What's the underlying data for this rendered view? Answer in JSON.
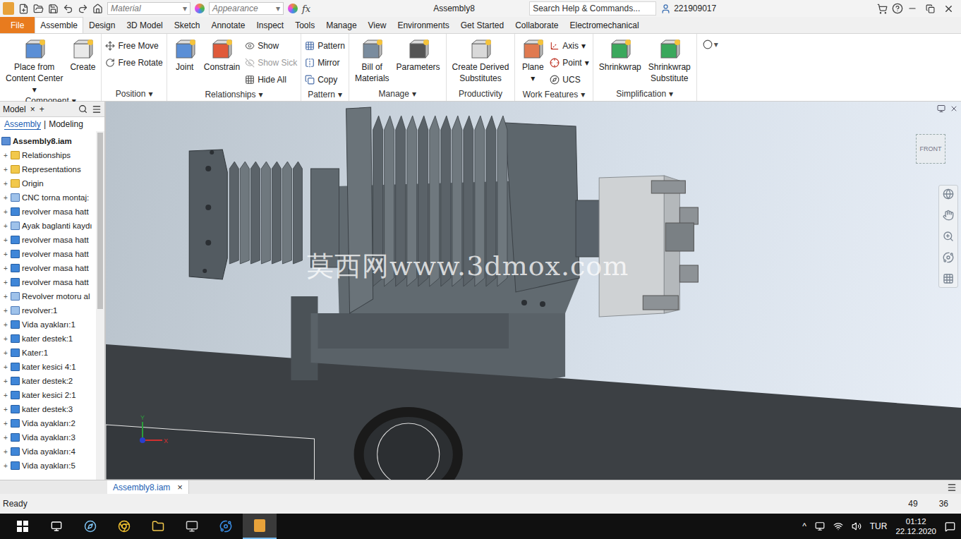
{
  "window": {
    "title": "Assembly8"
  },
  "quick_access": {
    "material": "Material",
    "appearance": "Appearance",
    "fx": "fx"
  },
  "search": {
    "placeholder": "Search Help & Commands..."
  },
  "user": "221909017",
  "tabs": [
    {
      "label": "File",
      "selected": false,
      "kind": "file"
    },
    {
      "label": "Assemble",
      "selected": true,
      "kind": "tab"
    },
    {
      "label": "Design",
      "selected": false,
      "kind": "tab"
    },
    {
      "label": "3D Model",
      "selected": false,
      "kind": "tab"
    },
    {
      "label": "Sketch",
      "selected": false,
      "kind": "tab"
    },
    {
      "label": "Annotate",
      "selected": false,
      "kind": "tab"
    },
    {
      "label": "Inspect",
      "selected": false,
      "kind": "tab"
    },
    {
      "label": "Tools",
      "selected": false,
      "kind": "tab"
    },
    {
      "label": "Manage",
      "selected": false,
      "kind": "tab"
    },
    {
      "label": "View",
      "selected": false,
      "kind": "tab"
    },
    {
      "label": "Environments",
      "selected": false,
      "kind": "tab"
    },
    {
      "label": "Get Started",
      "selected": false,
      "kind": "tab"
    },
    {
      "label": "Collaborate",
      "selected": false,
      "kind": "tab"
    },
    {
      "label": "Electromechanical",
      "selected": false,
      "kind": "tab"
    }
  ],
  "ribbon": {
    "dropdown_glyph": "▾",
    "groups": [
      {
        "label": "Component",
        "dropdown": true,
        "buttons": [
          {
            "lines": [
              "Place from",
              "Content Center"
            ],
            "kind": "large",
            "disabled": false,
            "dropdown": true
          },
          {
            "lines": [
              "Create"
            ],
            "kind": "large",
            "disabled": false,
            "dropdown": false
          }
        ]
      },
      {
        "label": "Position",
        "dropdown": true,
        "buttons": [
          {
            "lines": [
              "Free Move"
            ],
            "kind": "small",
            "disabled": false,
            "dropdown": false
          },
          {
            "lines": [
              "Free Rotate"
            ],
            "kind": "small",
            "disabled": false,
            "dropdown": false
          }
        ]
      },
      {
        "label": "Relationships",
        "dropdown": true,
        "buttons": [
          {
            "lines": [
              "Joint"
            ],
            "kind": "large",
            "disabled": false,
            "dropdown": false
          },
          {
            "lines": [
              "Constrain"
            ],
            "kind": "large",
            "disabled": false,
            "dropdown": false
          },
          {
            "lines": [
              "Show"
            ],
            "kind": "small",
            "disabled": false,
            "dropdown": false
          },
          {
            "lines": [
              "Show Sick"
            ],
            "kind": "small",
            "disabled": true,
            "dropdown": false
          },
          {
            "lines": [
              "Hide All"
            ],
            "kind": "small",
            "disabled": false,
            "dropdown": false
          }
        ]
      },
      {
        "label": "Pattern",
        "dropdown": true,
        "buttons": [
          {
            "lines": [
              "Pattern"
            ],
            "kind": "small",
            "disabled": false,
            "dropdown": false
          },
          {
            "lines": [
              "Mirror"
            ],
            "kind": "small",
            "disabled": false,
            "dropdown": false
          },
          {
            "lines": [
              "Copy"
            ],
            "kind": "small",
            "disabled": false,
            "dropdown": false
          }
        ]
      },
      {
        "label": "Manage",
        "dropdown": true,
        "buttons": [
          {
            "lines": [
              "Bill of",
              "Materials"
            ],
            "kind": "large",
            "disabled": false,
            "dropdown": false
          },
          {
            "lines": [
              "Parameters"
            ],
            "kind": "large",
            "disabled": false,
            "dropdown": false
          }
        ]
      },
      {
        "label": "Productivity",
        "dropdown": false,
        "buttons": [
          {
            "lines": [
              "Create Derived",
              "Substitutes"
            ],
            "kind": "large",
            "disabled": false,
            "dropdown": false
          }
        ]
      },
      {
        "label": "Work Features",
        "dropdown": true,
        "buttons": [
          {
            "lines": [
              "Plane"
            ],
            "kind": "large",
            "disabled": false,
            "dropdown": true
          },
          {
            "lines": [
              "Axis"
            ],
            "kind": "small",
            "disabled": false,
            "dropdown": true
          },
          {
            "lines": [
              "Point"
            ],
            "kind": "small",
            "disabled": false,
            "dropdown": true
          },
          {
            "lines": [
              "UCS"
            ],
            "kind": "small",
            "disabled": false,
            "dropdown": false
          }
        ]
      },
      {
        "label": "Simplification",
        "dropdown": true,
        "buttons": [
          {
            "lines": [
              "Shrinkwrap"
            ],
            "kind": "large",
            "disabled": false,
            "dropdown": false
          },
          {
            "lines": [
              "Shrinkwrap",
              "Substitute"
            ],
            "kind": "large",
            "disabled": false,
            "dropdown": false
          }
        ]
      }
    ]
  },
  "browser": {
    "title": "Model",
    "close": "×",
    "add": "+",
    "toggle": "+",
    "tabs": [
      {
        "label": "Assembly",
        "selected": true
      },
      {
        "label": "Modeling",
        "selected": false
      }
    ],
    "separator": "|",
    "items": [
      {
        "label": "Assembly8.iam",
        "kind": "root"
      },
      {
        "label": "Relationships",
        "kind": "folder"
      },
      {
        "label": "Representations",
        "kind": "folder"
      },
      {
        "label": "Origin",
        "kind": "folder"
      },
      {
        "label": "CNC torna montaj:",
        "kind": "assembly"
      },
      {
        "label": "revolver masa hatt",
        "kind": "part"
      },
      {
        "label": "Ayak baglanti kaydı",
        "kind": "assembly"
      },
      {
        "label": "revolver masa hatt",
        "kind": "part"
      },
      {
        "label": "revolver masa hatt",
        "kind": "part"
      },
      {
        "label": "revolver masa hatt",
        "kind": "part"
      },
      {
        "label": "revolver masa hatt",
        "kind": "part"
      },
      {
        "label": "Revolver motoru al",
        "kind": "assembly"
      },
      {
        "label": "revolver:1",
        "kind": "assembly"
      },
      {
        "label": "Vida ayakları:1",
        "kind": "part"
      },
      {
        "label": "kater destek:1",
        "kind": "part"
      },
      {
        "label": "Kater:1",
        "kind": "part"
      },
      {
        "label": "kater kesici 4:1",
        "kind": "part"
      },
      {
        "label": "kater destek:2",
        "kind": "part"
      },
      {
        "label": "kater kesici 2:1",
        "kind": "part"
      },
      {
        "label": "kater destek:3",
        "kind": "part"
      },
      {
        "label": "Vida ayakları:2",
        "kind": "part"
      },
      {
        "label": "Vida ayakları:3",
        "kind": "part"
      },
      {
        "label": "Vida ayakları:4",
        "kind": "part"
      },
      {
        "label": "Vida ayakları:5",
        "kind": "part"
      }
    ]
  },
  "viewport": {
    "viewcube": "FRONT",
    "watermark": "莫西网www.3dmox.com",
    "axis": {
      "x": "X",
      "y": "Y"
    }
  },
  "document_tabs": [
    {
      "label": "Assembly8.iam",
      "selected": true,
      "close": "×"
    }
  ],
  "status_bar": {
    "message": "Ready",
    "counts": [
      "49",
      "36"
    ]
  },
  "taskbar": {
    "language": "TUR",
    "time": "01:12",
    "date": "22.12.2020",
    "tray_arrow": "^"
  }
}
